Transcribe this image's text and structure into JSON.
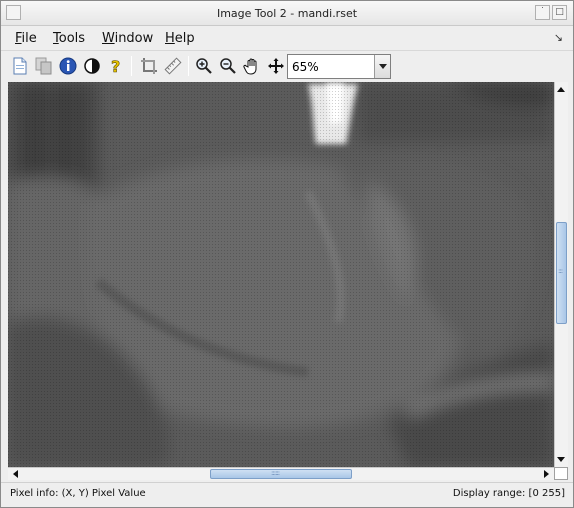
{
  "window": {
    "title": "Image Tool 2 - mandi.rset"
  },
  "menubar": {
    "items": [
      {
        "mnemonic": "F",
        "rest": "ile"
      },
      {
        "mnemonic": "T",
        "rest": "ools"
      },
      {
        "mnemonic": "W",
        "rest": "indow"
      },
      {
        "mnemonic": "H",
        "rest": "elp"
      }
    ]
  },
  "toolbar": {
    "zoom_value": "65%",
    "icons": [
      "new-document-icon",
      "copy-icon",
      "info-icon",
      "contrast-icon",
      "help-icon",
      "crop-icon",
      "ruler-icon",
      "zoom-in-icon",
      "zoom-out-icon",
      "pan-hand-icon",
      "move-icon"
    ]
  },
  "statusbar": {
    "pixel_info": "Pixel info: (X, Y)  Pixel Value",
    "display_range": "Display range: [0 255]"
  }
}
